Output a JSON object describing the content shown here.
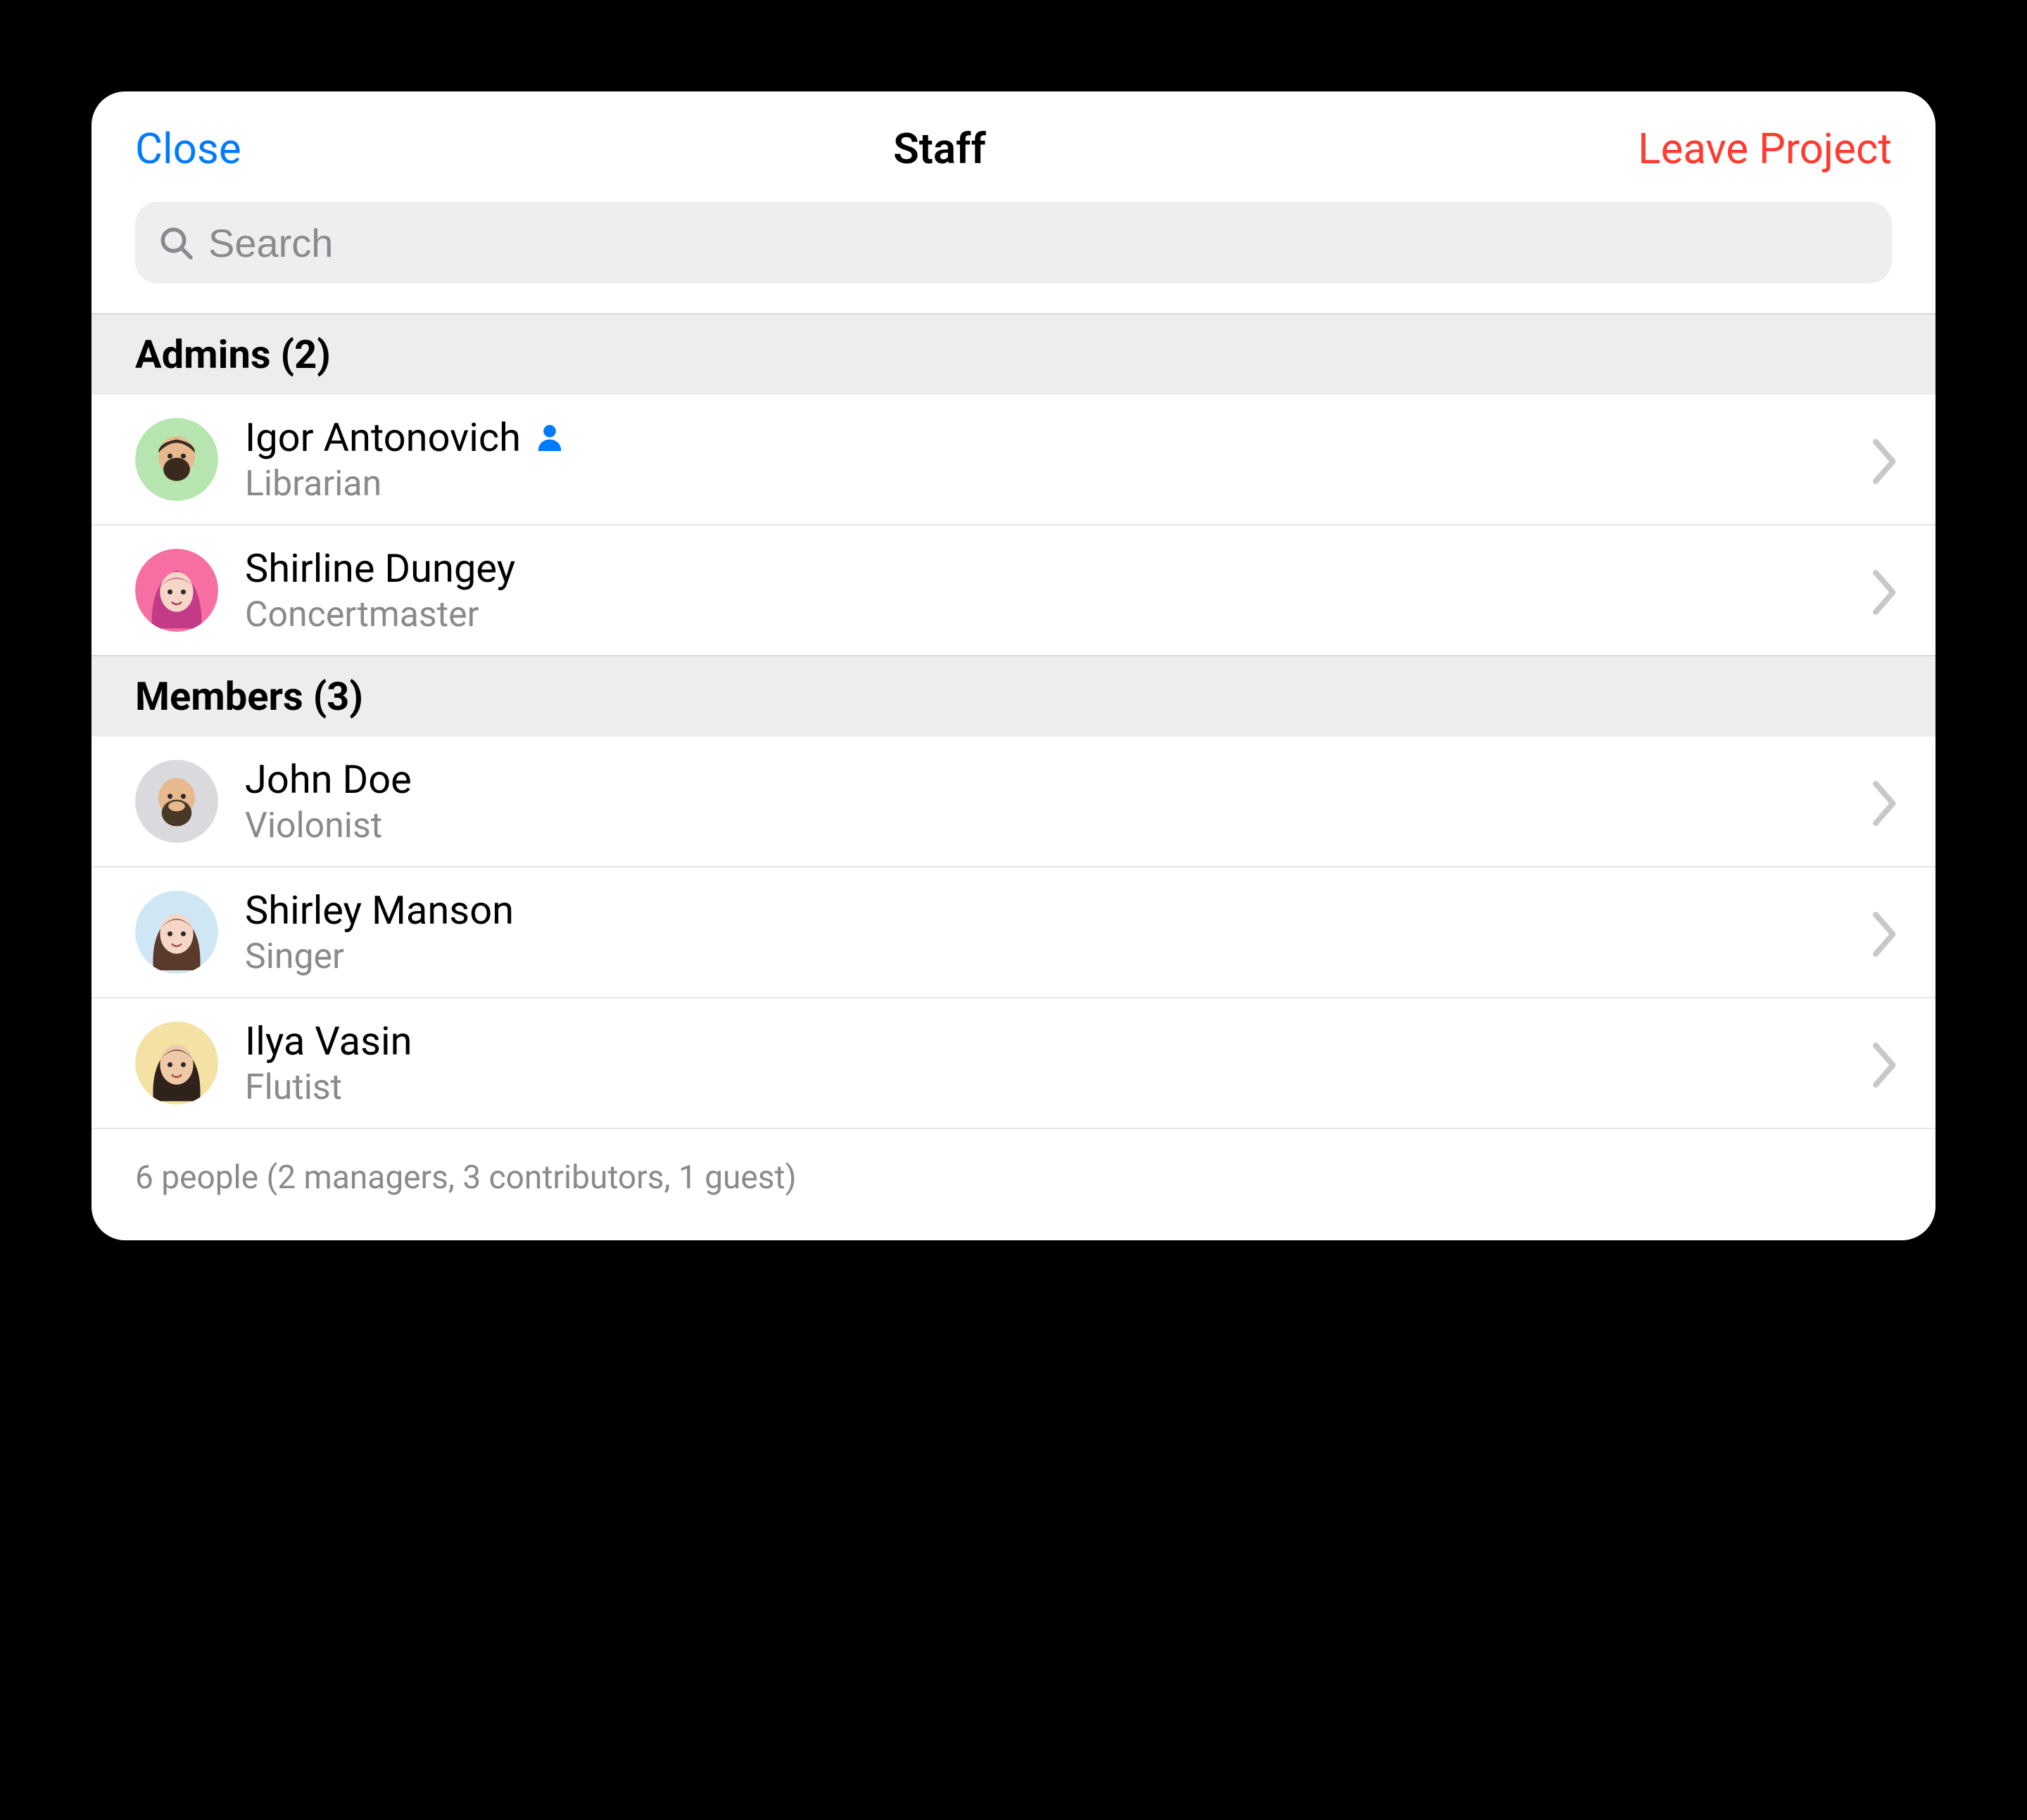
{
  "nav": {
    "close_label": "Close",
    "title": "Staff",
    "leave_label": "Leave Project"
  },
  "search": {
    "placeholder": "Search",
    "value": ""
  },
  "sections": {
    "admins": {
      "header": "Admins (2)",
      "rows": [
        {
          "name": "Igor Antonovich",
          "role": "Librarian",
          "is_self": true,
          "avatar_bg": "#b7e5b0"
        },
        {
          "name": "Shirline Dungey",
          "role": "Concertmaster",
          "is_self": false,
          "avatar_bg": "#f76fa2"
        }
      ]
    },
    "members": {
      "header": "Members (3)",
      "rows": [
        {
          "name": "John Doe",
          "role": "Violonist",
          "is_self": false,
          "avatar_bg": "#d9d9de"
        },
        {
          "name": "Shirley Manson",
          "role": "Singer",
          "is_self": false,
          "avatar_bg": "#cfe7f5"
        },
        {
          "name": "Ilya Vasin",
          "role": "Flutist",
          "is_self": false,
          "avatar_bg": "#f3e2a3"
        }
      ]
    }
  },
  "footer": {
    "summary": "6 people (2 managers, 3 contributors, 1 guest)"
  }
}
